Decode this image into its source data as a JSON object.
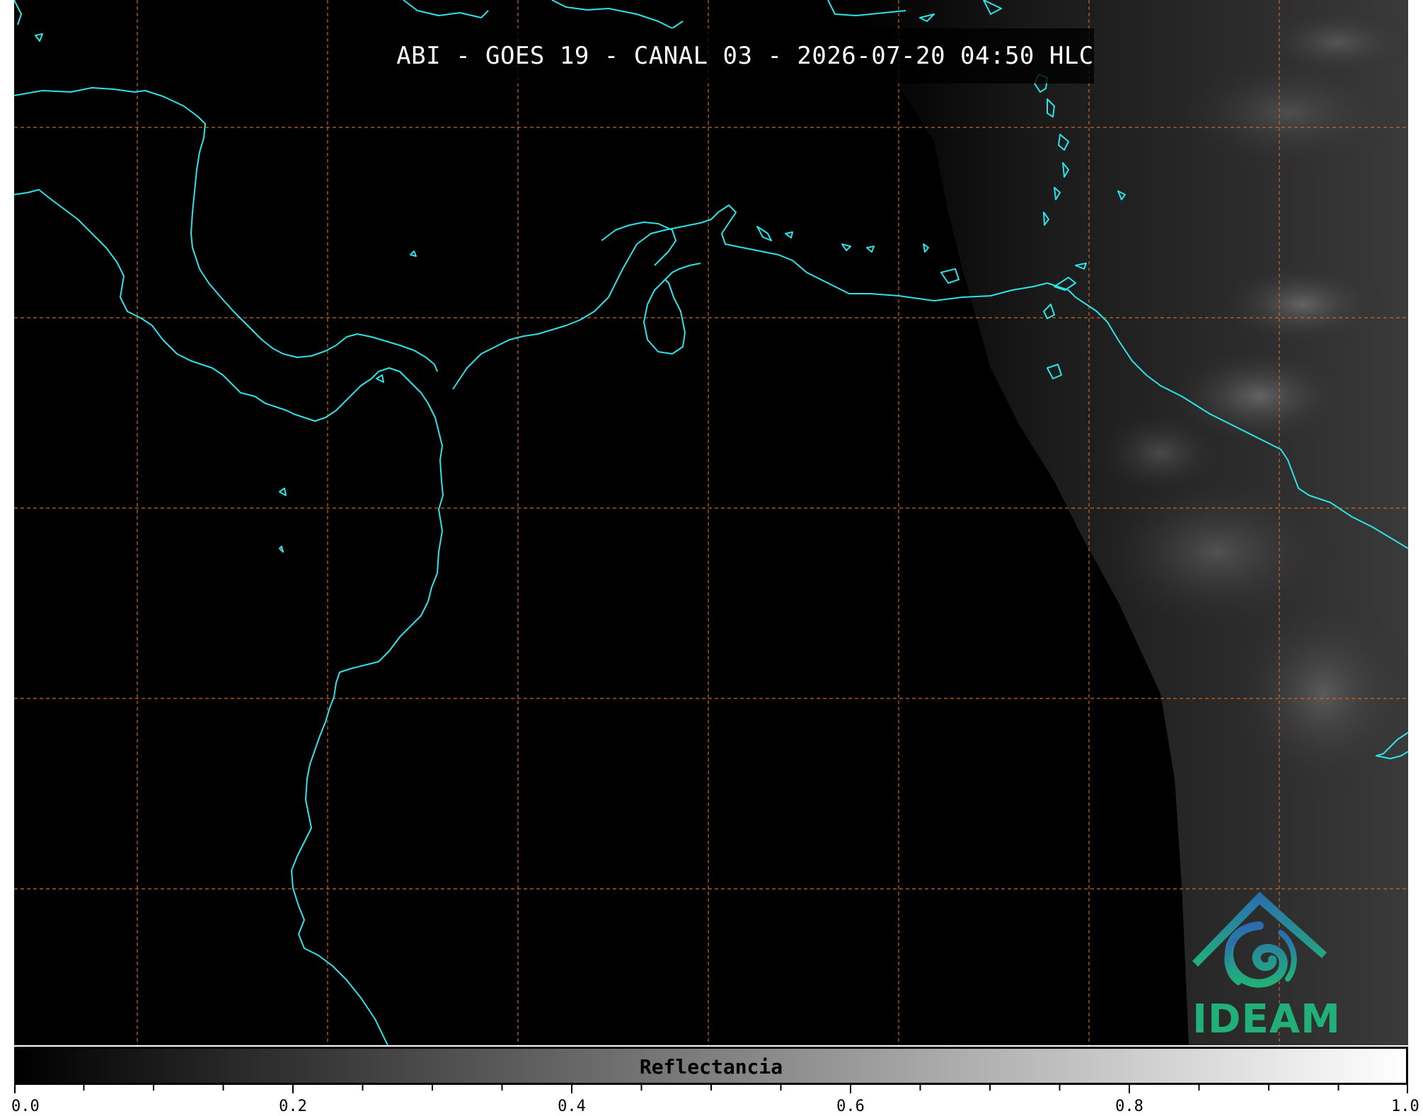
{
  "title": "ABI - GOES 19 - CANAL 03 - 2026-07-20 04:50 HLC",
  "logo": {
    "name": "ideam-logo",
    "text": "IDEAM",
    "colors": [
      "#2b6cb0",
      "#22b07a"
    ]
  },
  "colorbar": {
    "label": "Reflectancia",
    "min": 0.0,
    "max": 1.0,
    "colormap": "gray",
    "major_ticks": [
      "0.0",
      "0.2",
      "0.4",
      "0.6",
      "0.8",
      "1.0"
    ],
    "minor_step": 0.05
  },
  "map": {
    "coastline_color": "#2de3e8",
    "grid_color": "#c86a1e",
    "grid_style": "dashed",
    "background": "#000000"
  }
}
